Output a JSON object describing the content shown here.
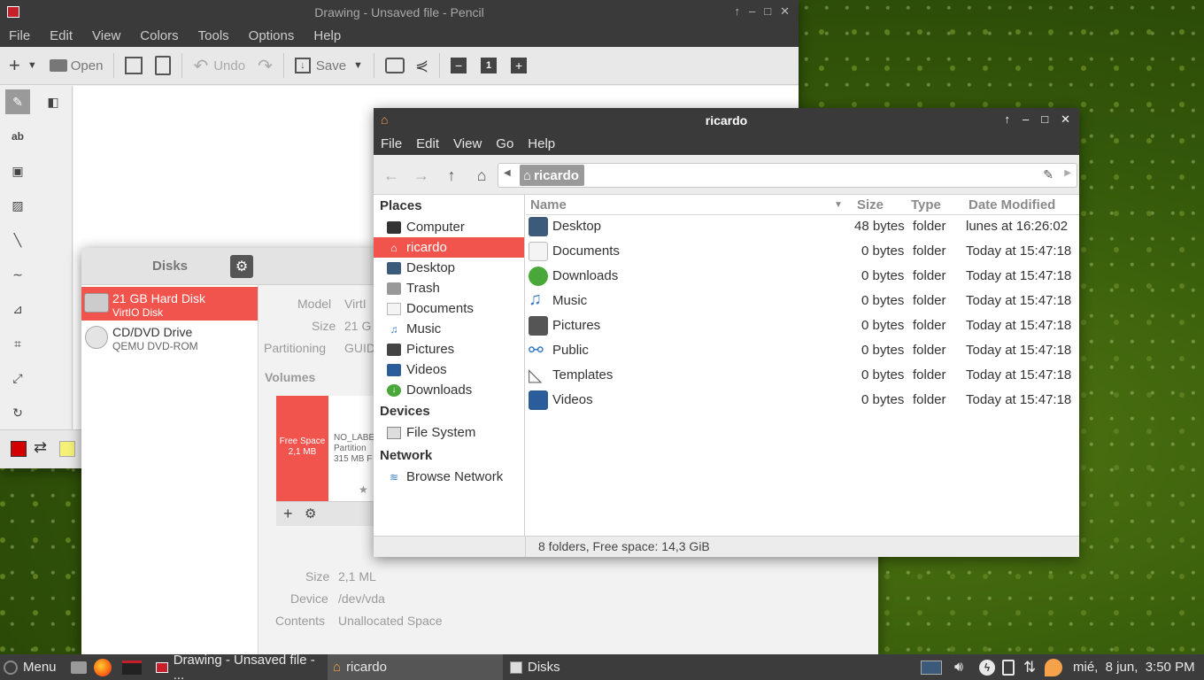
{
  "pencil": {
    "title": "Drawing - Unsaved file - Pencil",
    "menu": [
      "File",
      "Edit",
      "View",
      "Colors",
      "Tools",
      "Options",
      "Help"
    ],
    "toolbar": {
      "open": "Open",
      "undo": "Undo",
      "save": "Save",
      "page": "1"
    },
    "tools": {
      "text_tool": "ab"
    },
    "colors": {
      "primary": "#d40000",
      "secondary": "#f5f078"
    }
  },
  "disks": {
    "title": "Disks",
    "devices": [
      {
        "name": "21 GB Hard Disk",
        "sub": "VirtIO Disk"
      },
      {
        "name": "CD/DVD Drive",
        "sub": "QEMU DVD-ROM"
      }
    ],
    "info": {
      "model_label": "Model",
      "model_value": "VirtI",
      "size_label": "Size",
      "size_value": "21 G",
      "partitioning_label": "Partitioning",
      "partitioning_value": "GUID"
    },
    "volumes_heading": "Volumes",
    "volume_free": {
      "line1": "Free Space",
      "line2": "2,1 MB"
    },
    "volume_part": {
      "line1": "NO_LABE",
      "line2": "Partition",
      "line3": "315 MB F"
    },
    "detail": {
      "size_label": "Size",
      "size_value": "2,1 ML",
      "device_label": "Device",
      "device_value": "/dev/vda",
      "contents_label": "Contents",
      "contents_value": "Unallocated Space"
    }
  },
  "fm": {
    "title": "ricardo",
    "menu": [
      "File",
      "Edit",
      "View",
      "Go",
      "Help"
    ],
    "path": "ricardo",
    "sections": {
      "places": "Places",
      "devices": "Devices",
      "network": "Network"
    },
    "places": [
      "Computer",
      "ricardo",
      "Desktop",
      "Trash",
      "Documents",
      "Music",
      "Pictures",
      "Videos",
      "Downloads"
    ],
    "devices": [
      "File System"
    ],
    "network": [
      "Browse Network"
    ],
    "columns": {
      "name": "Name",
      "size": "Size",
      "type": "Type",
      "date": "Date Modified"
    },
    "rows": [
      {
        "name": "Desktop",
        "size": "48 bytes",
        "type": "folder",
        "date": "lunes at 16:26:02"
      },
      {
        "name": "Documents",
        "size": "0 bytes",
        "type": "folder",
        "date": "Today at 15:47:18"
      },
      {
        "name": "Downloads",
        "size": "0 bytes",
        "type": "folder",
        "date": "Today at 15:47:18"
      },
      {
        "name": "Music",
        "size": "0 bytes",
        "type": "folder",
        "date": "Today at 15:47:18"
      },
      {
        "name": "Pictures",
        "size": "0 bytes",
        "type": "folder",
        "date": "Today at 15:47:18"
      },
      {
        "name": "Public",
        "size": "0 bytes",
        "type": "folder",
        "date": "Today at 15:47:18"
      },
      {
        "name": "Templates",
        "size": "0 bytes",
        "type": "folder",
        "date": "Today at 15:47:18"
      },
      {
        "name": "Videos",
        "size": "0 bytes",
        "type": "folder",
        "date": "Today at 15:47:18"
      }
    ],
    "status": "8 folders, Free space: 14,3 GiB"
  },
  "taskbar": {
    "menu": "Menu",
    "tasks": [
      "Drawing - Unsaved file - ...",
      "ricardo",
      "Disks"
    ],
    "clock": "mié,  8 jun,  3:50 PM"
  },
  "accent": "#f1544d"
}
